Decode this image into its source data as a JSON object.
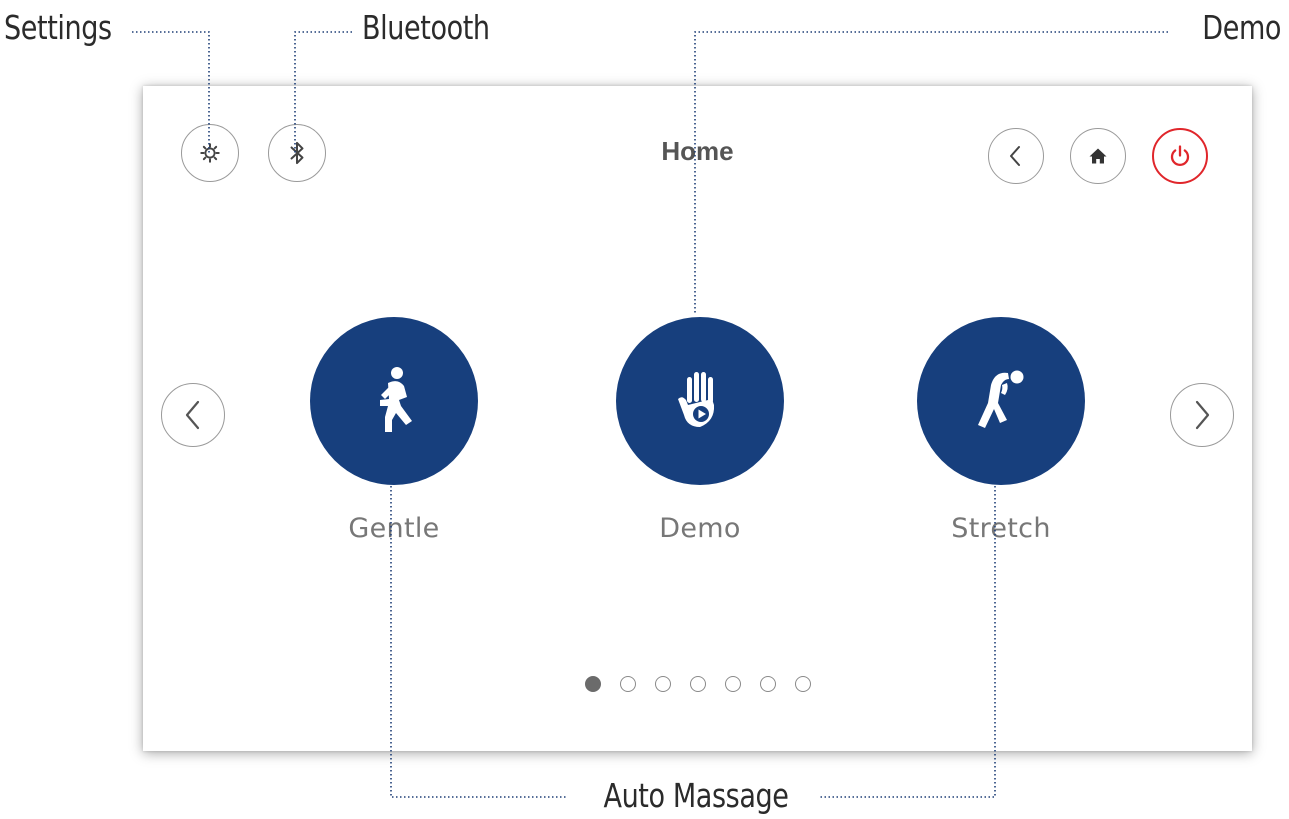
{
  "callouts": {
    "settings": "Settings",
    "bluetooth": "Bluetooth",
    "demo": "Demo",
    "auto_massage": "Auto Massage"
  },
  "header": {
    "title": "Home",
    "left_icons": [
      "gear-icon",
      "bluetooth-icon"
    ],
    "right_icons": [
      "chevron-left-icon",
      "home-icon",
      "power-icon"
    ]
  },
  "programs": [
    {
      "label": "Gentle",
      "icon": "walking-figure-icon"
    },
    {
      "label": "Demo",
      "icon": "hand-play-icon"
    },
    {
      "label": "Stretch",
      "icon": "stretching-figure-icon"
    }
  ],
  "carousel": {
    "page_count": 7,
    "current_page": 1
  },
  "colors": {
    "program_disc": "#173f7d",
    "power_accent": "#e0262b",
    "guide_line": "#1f3f77",
    "label_text": "#777777"
  }
}
